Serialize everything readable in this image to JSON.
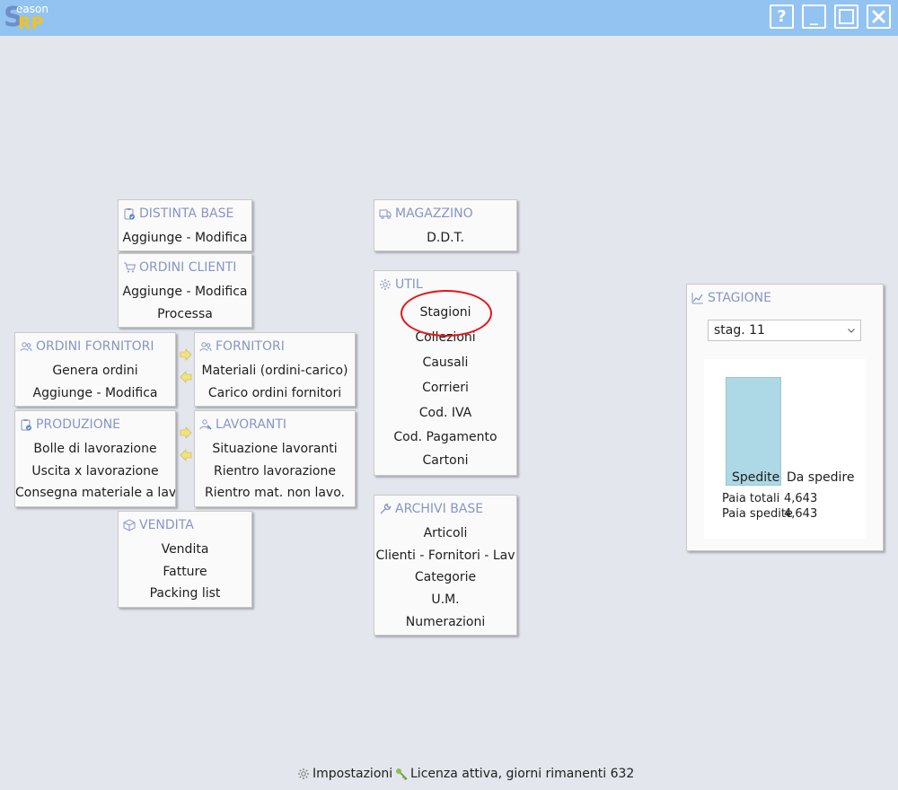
{
  "app": {
    "logo_s": "S",
    "logo_ea": "eason",
    "logo_rp": "RP"
  },
  "window_controls": {
    "help": "?",
    "minimize": "_",
    "maximize": "☐",
    "close": "✕"
  },
  "panels": {
    "distinta_base": {
      "title": "DISTINTA BASE",
      "items": [
        "Aggiunge - Modifica"
      ]
    },
    "ordini_clienti": {
      "title": "ORDINI CLIENTI",
      "items": [
        "Aggiunge - Modifica",
        "Processa"
      ]
    },
    "ordini_fornitori": {
      "title": "ORDINI FORNITORI",
      "items": [
        "Genera ordini",
        "Aggiunge - Modifica"
      ]
    },
    "fornitori": {
      "title": "FORNITORI",
      "items": [
        "Materiali (ordini-carico)",
        "Carico ordini fornitori"
      ]
    },
    "produzione": {
      "title": "PRODUZIONE",
      "items": [
        "Bolle di lavorazione",
        "Uscita x lavorazione",
        "Consegna materiale a lavoi"
      ]
    },
    "lavoranti": {
      "title": "LAVORANTI",
      "items": [
        "Situazione lavoranti",
        "Rientro lavorazione",
        "Rientro mat. non lavo."
      ]
    },
    "vendita": {
      "title": "VENDITA",
      "items": [
        "Vendita",
        "Fatture",
        "Packing list"
      ]
    },
    "magazzino": {
      "title": "MAGAZZINO",
      "items": [
        "D.D.T."
      ]
    },
    "util": {
      "title": "UTIL",
      "items": [
        "Stagioni",
        "Collezioni",
        "Causali",
        "Corrieri",
        "Cod. IVA",
        "Cod. Pagamento",
        "Cartoni"
      ]
    },
    "archivi_base": {
      "title": "ARCHIVI BASE",
      "items": [
        "Articoli",
        "Clienti - Fornitori - Lav",
        "Categorie",
        "U.M.",
        "Numerazioni"
      ]
    }
  },
  "stagione": {
    "title": "STAGIONE",
    "season_select": "stag. 11",
    "chart_labels": {
      "spedite": "Spedite",
      "da_spedire": "Da spedire"
    },
    "paia_totali_label": "Paia totali",
    "paia_totali_value": "4,643",
    "paia_spedite_label": "Paia spedite",
    "paia_spedite_value": "4,643",
    "bar_fraction_spedite": 1.0
  },
  "footer": {
    "settings": "Impostazioni",
    "license": "Licenza attiva, giorni rimanenti 632"
  },
  "colors": {
    "titlebar": "#93c3f1",
    "panel_title": "#8796c4",
    "bar": "#add8e6",
    "highlight_circle": "#e3161b",
    "arrow": "#f3e27a"
  }
}
